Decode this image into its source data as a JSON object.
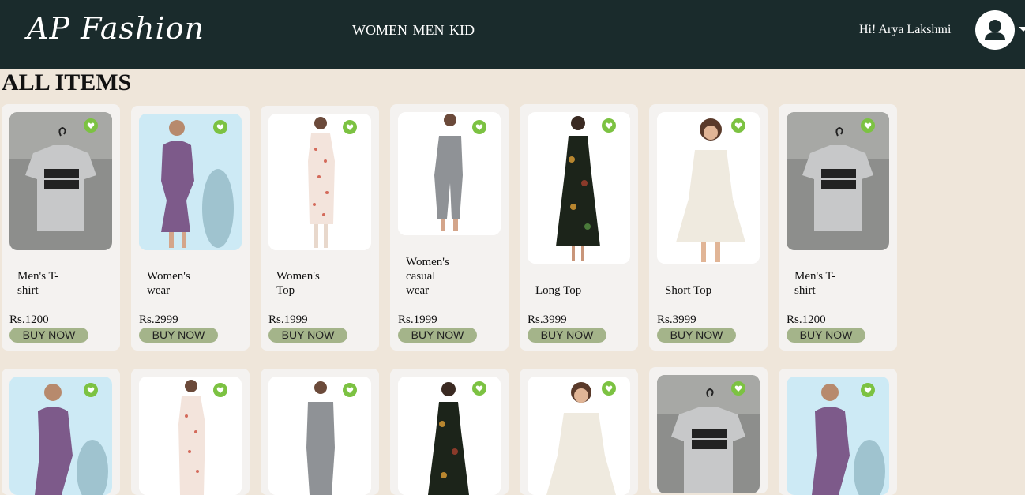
{
  "header": {
    "logo": "AP Fashion",
    "nav_label": "WOMEN MEN KID",
    "greeting": "Hi! Arya Lakshmi"
  },
  "page": {
    "heading": "ALL ITEMS"
  },
  "products_row1": [
    {
      "name": "Men's T-shirt",
      "price": "Rs.1200",
      "button": "BUY NOW",
      "image": "tshirt"
    },
    {
      "name": "Women's wear",
      "price": "Rs.2999",
      "button": "BUY NOW",
      "image": "purple-dress"
    },
    {
      "name": "Women's Top",
      "price": "Rs.1999",
      "button": "BUY NOW",
      "image": "floral-kurta"
    },
    {
      "name": "Women's casual wear",
      "price": "Rs.1999",
      "button": "BUY NOW",
      "image": "jumpsuit"
    },
    {
      "name": "Long Top",
      "price": "Rs.3999",
      "button": "BUY NOW",
      "image": "long-dress"
    },
    {
      "name": "Short Top",
      "price": "Rs.3999",
      "button": "BUY NOW",
      "image": "white-dress"
    },
    {
      "name": "Men's T-shirt",
      "price": "Rs.1200",
      "button": "BUY NOW",
      "image": "tshirt"
    }
  ],
  "products_row2": [
    {
      "image": "purple-dress"
    },
    {
      "image": "floral-kurta"
    },
    {
      "image": "jumpsuit"
    },
    {
      "image": "long-dress"
    },
    {
      "image": "white-dress"
    },
    {
      "image": "tshirt"
    },
    {
      "image": "purple-dress"
    }
  ],
  "colors": {
    "header_bg": "#1a2b2c",
    "page_bg": "#efe6da",
    "button_bg": "#a4b48a",
    "heart": "#7cc242"
  },
  "icons": {
    "avatar": "user-silhouette-icon",
    "wishlist": "heart-icon",
    "dropdown": "caret-down-icon"
  }
}
